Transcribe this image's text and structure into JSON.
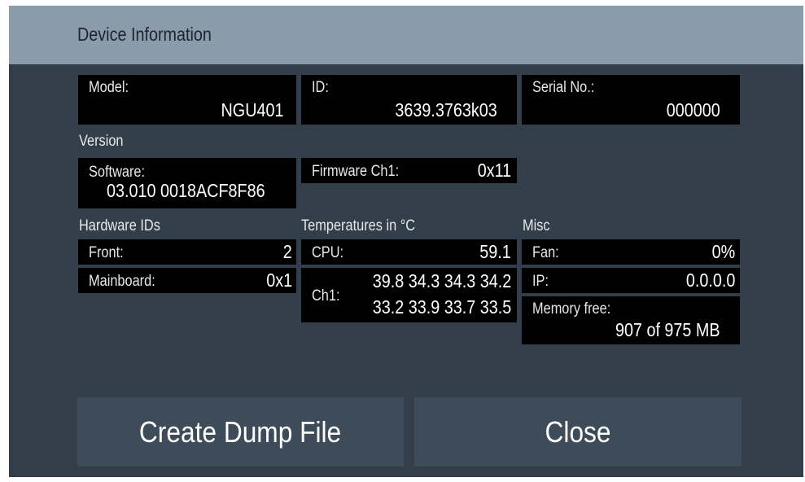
{
  "dialog": {
    "title": "Device Information"
  },
  "model": {
    "label": "Model:",
    "value": "NGU401"
  },
  "id": {
    "label": "ID:",
    "value": "3639.3763k03"
  },
  "serial": {
    "label": "Serial No.:",
    "value": "000000"
  },
  "version": {
    "heading": "Version",
    "software_label": "Software:",
    "software_value": "03.010 0018ACF8F86",
    "firmware_label": "Firmware Ch1:",
    "firmware_value": "0x11"
  },
  "hardware": {
    "heading": "Hardware IDs",
    "front_label": "Front:",
    "front_value": "2",
    "mainboard_label": "Mainboard:",
    "mainboard_value": "0x1"
  },
  "temperatures": {
    "heading": "Temperatures in °C",
    "cpu_label": "CPU:",
    "cpu_value": "59.1",
    "ch1_label": "Ch1:",
    "ch1_row1": "39.8 34.3 34.3 34.2",
    "ch1_row2": "33.2 33.9 33.7 33.5"
  },
  "misc": {
    "heading": "Misc",
    "fan_label": "Fan:",
    "fan_value": "0%",
    "ip_label": "IP:",
    "ip_value": "0.0.0.0",
    "memory_label": "Memory free:",
    "memory_value": "907 of 975 MB"
  },
  "buttons": {
    "dump": "Create Dump File",
    "close": "Close"
  }
}
